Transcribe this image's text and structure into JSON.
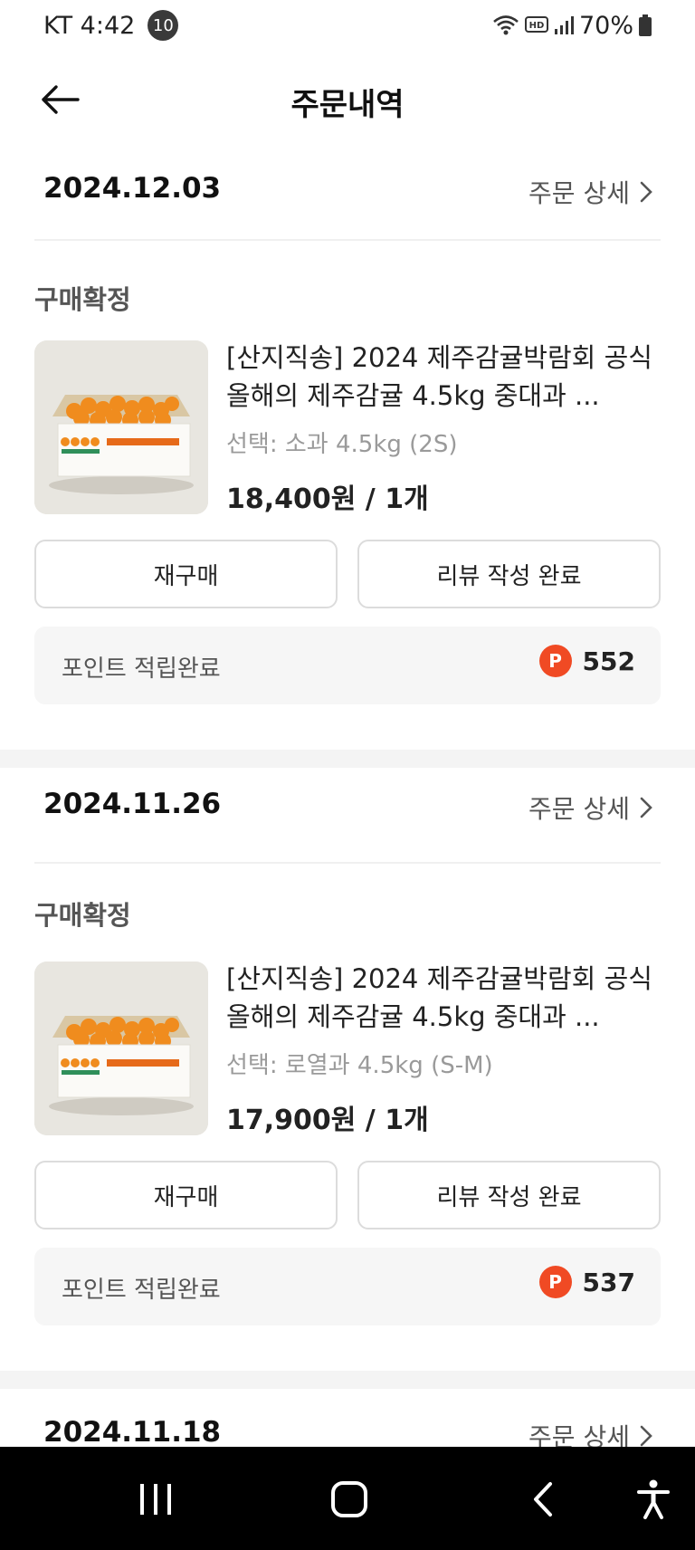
{
  "status_bar": {
    "carrier_time": "KT 4:42",
    "notification_count": "10",
    "battery": "70%",
    "icons": [
      "wifi-icon",
      "hd-icon",
      "signal-icon",
      "battery-icon"
    ]
  },
  "header": {
    "title": "주문내역",
    "back_icon": "arrow-left-icon"
  },
  "orders": [
    {
      "date": "2024.12.03",
      "detail_label": "주문 상세",
      "status": "구매확정",
      "product_title": "[산지직송] 2024 제주감귤박람회 공식 올해의 제주감귤 4.5kg 중대과 ...",
      "option": "선택: 소과 4.5kg (2S)",
      "price": "18,400원 / 1개",
      "rebuy_label": "재구매",
      "review_label": "리뷰 작성 완료",
      "points_label": "포인트 적립완료",
      "points_icon": "P",
      "points_value": "552"
    },
    {
      "date": "2024.11.26",
      "detail_label": "주문 상세",
      "status": "구매확정",
      "product_title": "[산지직송] 2024 제주감귤박람회 공식 올해의 제주감귤 4.5kg 중대과 ...",
      "option": "선택: 로열과 4.5kg (S-M)",
      "price": "17,900원 / 1개",
      "rebuy_label": "재구매",
      "review_label": "리뷰 작성 완료",
      "points_label": "포인트 적립완료",
      "points_icon": "P",
      "points_value": "537"
    },
    {
      "date": "2024.11.18",
      "detail_label": "주문 상세"
    }
  ],
  "colors": {
    "points_badge": "#f04a24",
    "orange": "#f08c1e",
    "nav_bg": "#000000"
  }
}
